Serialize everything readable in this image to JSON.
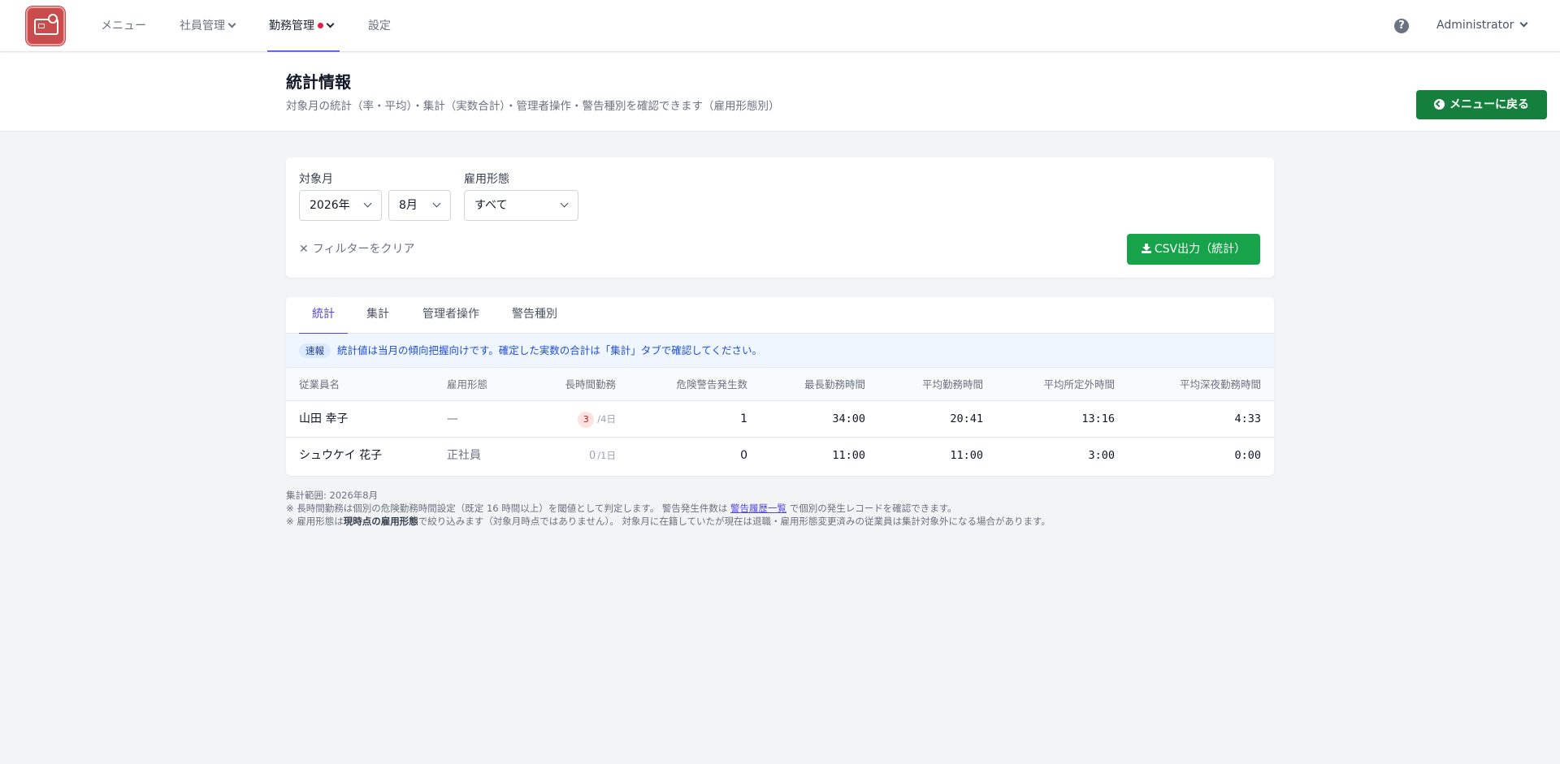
{
  "nav": {
    "items": [
      {
        "label": "メニュー"
      },
      {
        "label": "社員管理"
      },
      {
        "label": "勤務管理"
      },
      {
        "label": "設定"
      }
    ],
    "user": "Administrator",
    "help_icon": "question-circle-icon"
  },
  "header": {
    "title": "統計情報",
    "subtitle": "対象月の統計（率・平均）・集計（実数合計）・管理者操作・警告種別を確認できます（雇用形態別）",
    "back_button": "メニューに戻る"
  },
  "filters": {
    "month_label": "対象月",
    "year_value": "2026年",
    "month_value": "8月",
    "employment_label": "雇用形態",
    "employment_value": "すべて",
    "clear_label": "フィルターをクリア",
    "csv_label": "CSV出力（統計）"
  },
  "tabs": [
    {
      "label": "統計",
      "active": true
    },
    {
      "label": "集計"
    },
    {
      "label": "管理者操作"
    },
    {
      "label": "警告種別"
    }
  ],
  "notice": {
    "badge": "速報",
    "text": "統計値は当月の傾向把握向けです。確定した実数の合計は「集計」タブで確認してください。"
  },
  "table": {
    "columns": [
      "従業員名",
      "雇用形態",
      "長時間勤務",
      "危険警告発生数",
      "最長勤務時間",
      "平均勤務時間",
      "平均所定外時間",
      "平均深夜勤務時間"
    ],
    "rows": [
      {
        "name": "山田 幸子",
        "employment": "—",
        "long_count": "3",
        "long_days": "/4日",
        "danger": "1",
        "max_work": "34:00",
        "avg_work": "20:41",
        "avg_overtime": "13:16",
        "avg_night": "4:33"
      },
      {
        "name": "シュウケイ 花子",
        "employment": "正社員",
        "long_count": "0",
        "long_days": "/1日",
        "danger": "0",
        "max_work": "11:00",
        "avg_work": "11:00",
        "avg_overtime": "3:00",
        "avg_night": "0:00"
      }
    ]
  },
  "footnotes": {
    "range": "集計範囲: 2026年8月",
    "line1_a": "※ 長時間勤務は個別の危険勤務時間設定（既定 16 時間以上）を閾値として判定します。 警告発生件数は ",
    "line1_link": "警告履歴一覧",
    "line1_b": " で個別の発生レコードを確認できます。",
    "line2_a": "※ 雇用形態は",
    "line2_bold": "現時点の雇用形態",
    "line2_b": "で絞り込みます（対象月時点ではありません）。 対象月に在籍していたが現在は退職・雇用形態変更済みの従業員は集計対象外になる場合があります。"
  },
  "colors": {
    "accent": "#4f46e5",
    "success": "#16a34a",
    "back_button": "#15803d",
    "logo": "#c94b4b",
    "alert_dot": "#e11d48"
  }
}
